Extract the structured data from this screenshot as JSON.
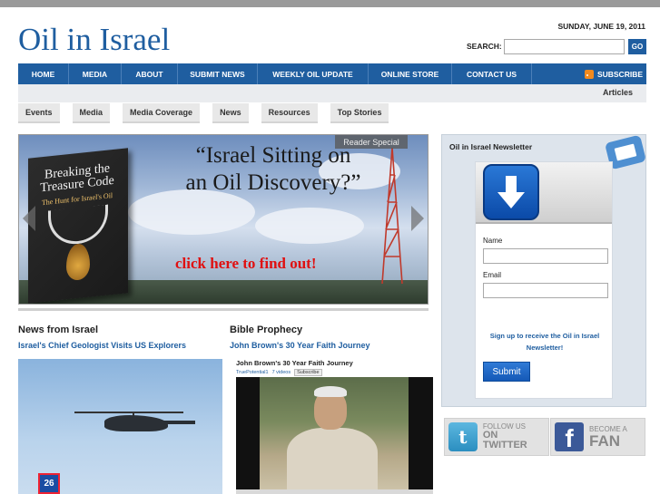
{
  "site": {
    "logo": "Oil in Israel",
    "date": "SUNDAY, JUNE 19, 2011"
  },
  "search": {
    "label": "SEARCH:",
    "value": "",
    "button": "GO"
  },
  "main_nav": {
    "items": [
      "HOME",
      "MEDIA",
      "ABOUT",
      "SUBMIT NEWS",
      "WEEKLY OIL UPDATE",
      "ONLINE STORE",
      "CONTACT US"
    ],
    "subscribe": "SUBSCRIBE",
    "articles": "Articles"
  },
  "sub_nav": [
    "Events",
    "Media",
    "Media Coverage",
    "News",
    "Resources",
    "Top Stories"
  ],
  "hero": {
    "book_title": "Breaking the Treasure Code",
    "book_subtitle": "The Hunt for Israel's Oil",
    "headline_line1": "“Israel Sitting on",
    "headline_line2": "an Oil Discovery?”",
    "cta": "click here to find out!",
    "badge": "Reader Special"
  },
  "news": {
    "title": "News from Israel",
    "link": "Israel's Chief Geologist Visits US Explorers",
    "station_logo": "26"
  },
  "prophecy": {
    "title": "Bible Prophecy",
    "link": "John Brown's 30 Year Faith Journey",
    "video_title": "John Brown's 30 Year Faith Journey",
    "video_channel": "TruePotential1",
    "video_count": "7 videos",
    "video_subscribe": "Subscribe"
  },
  "newsletter": {
    "title": "Oil in Israel Newsletter",
    "name_label": "Name",
    "email_label": "Email",
    "signup_line1": "Sign up to receive the Oil in Israel",
    "signup_line2": "Newsletter!",
    "submit": "Submit"
  },
  "social": {
    "twitter_small": "FOLLOW US",
    "twitter_big": "ON TWITTER",
    "facebook_small": "BECOME A",
    "facebook_big": "FAN"
  },
  "colors": {
    "brand": "#1f5ea0",
    "cta": "#e01010",
    "rss": "#f28a1e",
    "facebook": "#3b5998",
    "twitter": "#2b8ec0"
  }
}
